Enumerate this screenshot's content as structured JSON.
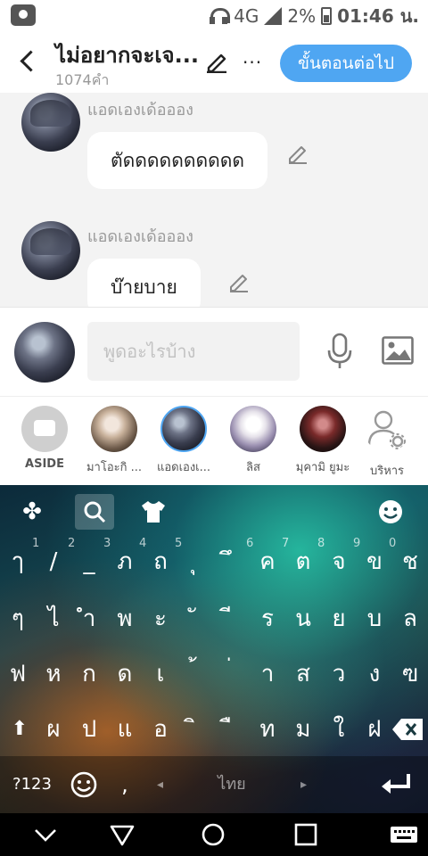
{
  "status_bar": {
    "network": "4G",
    "battery": "2%",
    "time": "01:46 น."
  },
  "header": {
    "title": "ไม่อยากจะเจ...",
    "word_count": "1074คำ",
    "more_label": "···",
    "next_button": "ขั้นตอนต่อไป"
  },
  "messages": [
    {
      "sender": "แอดเองเด้อออง",
      "text": "ตัดดดดดดดดดด"
    },
    {
      "sender": "แอดเองเด้อออง",
      "text": "บ๊ายบาย"
    }
  ],
  "input": {
    "placeholder": "พูดอะไรบ้าง"
  },
  "characters": [
    {
      "label": "ASIDE"
    },
    {
      "label": "มาโอะกิ ..."
    },
    {
      "label": "แอดเองเ..."
    },
    {
      "label": "ลิส"
    },
    {
      "label": "มุคามิ ยูมะ"
    },
    {
      "label": "บริหาร"
    }
  ],
  "keyboard": {
    "number_hints": [
      "1",
      "2",
      "3",
      "4",
      "5",
      "6",
      "7",
      "8",
      "9",
      "0"
    ],
    "rows": [
      [
        "ๅ",
        "/",
        "_",
        "ภ",
        "ถ",
        "ุ",
        "ึ",
        "ค",
        "ต",
        "จ",
        "ข",
        "ช"
      ],
      [
        "ๆ",
        "ไ",
        "ำ",
        "พ",
        "ะ",
        "ั",
        "ี",
        "ร",
        "น",
        "ย",
        "บ",
        "ล"
      ],
      [
        "ฟ",
        "ห",
        "ก",
        "ด",
        "เ",
        "้",
        "่",
        "า",
        "ส",
        "ว",
        "ง",
        "ฃ"
      ],
      [
        "ผ",
        "ป",
        "แ",
        "อ",
        "ิ",
        "ื",
        "ท",
        "ม",
        "ใ",
        "ฝ"
      ]
    ],
    "symbols_key": "?123",
    "comma_key": ",",
    "space_label": "ไทย"
  },
  "colors": {
    "accent": "#4fa6f2",
    "bubble": "#ffffff",
    "background": "#f3f3f3"
  }
}
